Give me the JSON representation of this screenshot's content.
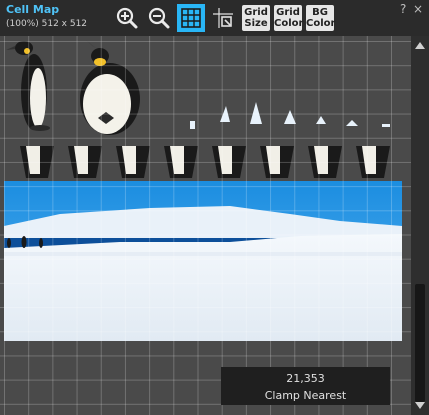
{
  "panel": {
    "title": "Cell Map",
    "info": "(100%) 512 x 512"
  },
  "toolbar": {
    "zoom_in_icon": "zoom-in-icon",
    "zoom_out_icon": "zoom-out-icon",
    "grid_toggle_icon": "grid-icon",
    "fit_icon": "fit-icon",
    "grid_size_line1": "Grid",
    "grid_size_line2": "Size",
    "grid_color_line1": "Grid",
    "grid_color_line2": "Color",
    "bg_color_line1": "BG",
    "bg_color_line2": "Color",
    "accent": "#29b6f6"
  },
  "window": {
    "help": "?",
    "close": "×"
  },
  "status": {
    "coords": "21,353",
    "sampling": "Clamp  Nearest"
  }
}
